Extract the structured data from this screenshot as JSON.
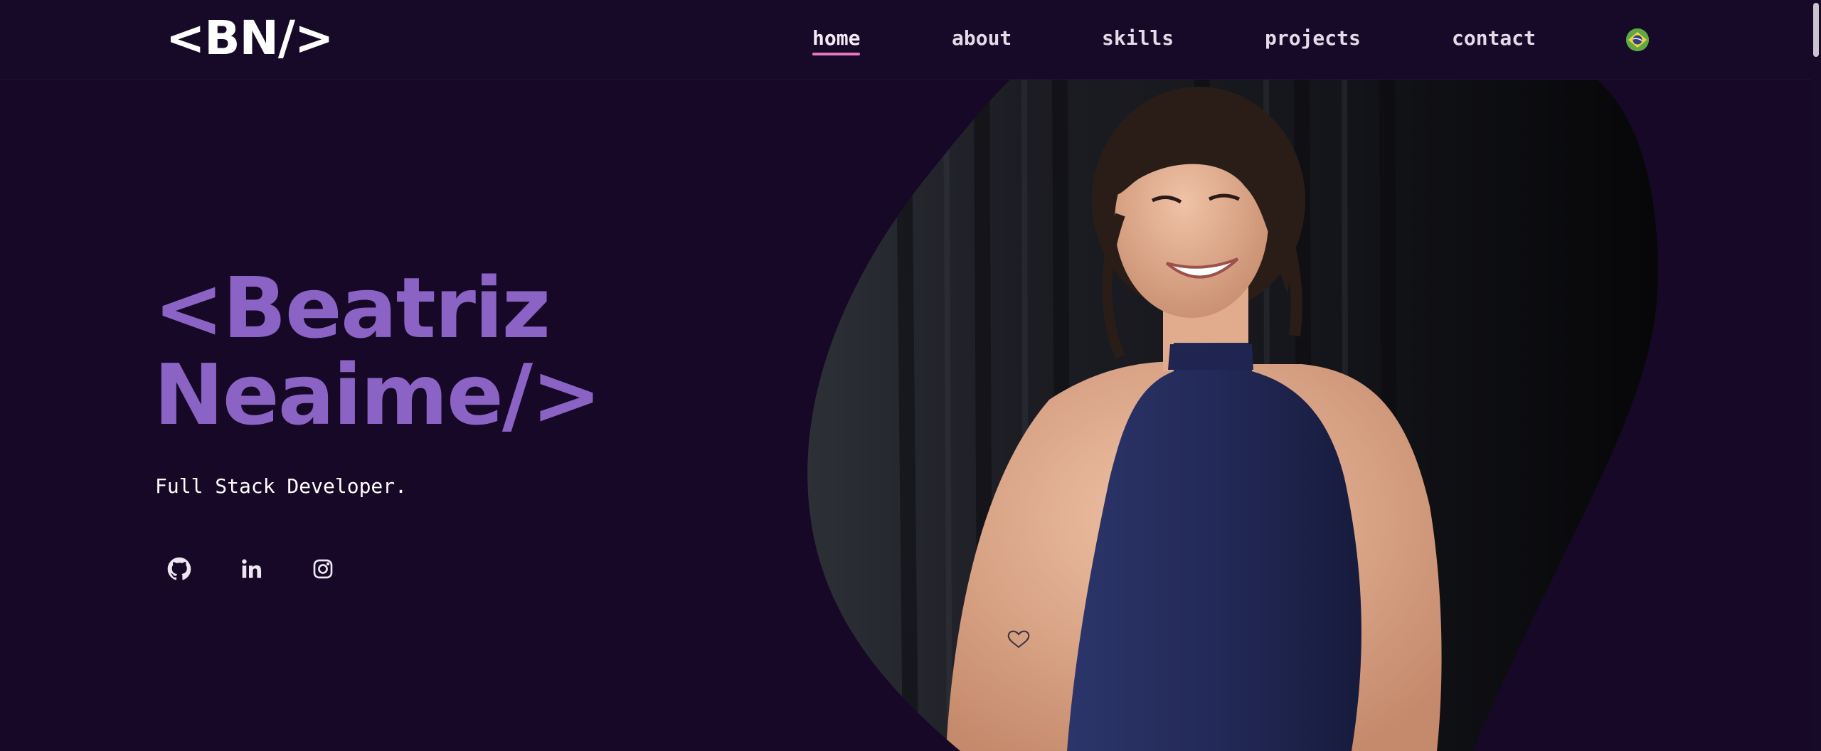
{
  "header": {
    "logo_text": "<BN/>",
    "nav": [
      {
        "label": "home",
        "active": true
      },
      {
        "label": "about",
        "active": false
      },
      {
        "label": "skills",
        "active": false
      },
      {
        "label": "projects",
        "active": false
      },
      {
        "label": "contact",
        "active": false
      }
    ],
    "language_icon": "brazil-flag-icon"
  },
  "hero": {
    "name_line1": "<Beatriz",
    "name_line2": "Neaime/>",
    "role": "Full Stack Developer.",
    "socials": [
      {
        "icon": "github-icon"
      },
      {
        "icon": "linkedin-icon"
      },
      {
        "icon": "instagram-icon"
      }
    ],
    "photo": "portrait-photo"
  },
  "colors": {
    "background": "#160826",
    "header_bg": "#170a29",
    "accent_purple": "#8a63c4",
    "active_underline": "#e873be",
    "nav_text": "#e2dbe8"
  }
}
